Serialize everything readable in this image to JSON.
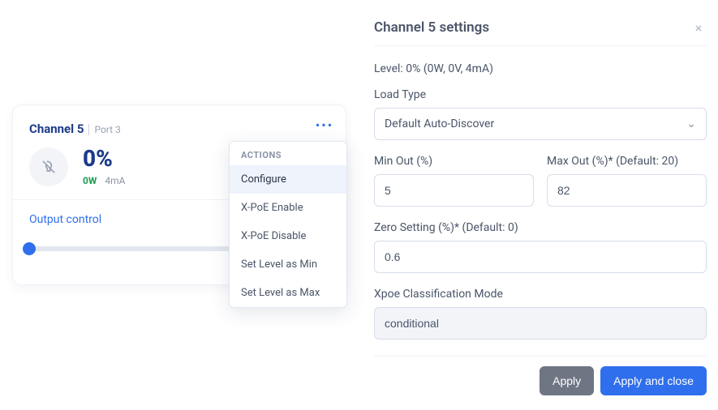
{
  "card": {
    "title": "Channel 5",
    "port_label": "Port 3",
    "percent": "0%",
    "power": "0W",
    "current": "4mA",
    "output_label": "Output control",
    "output_value": "0"
  },
  "actions": {
    "heading": "ACTIONS",
    "items": [
      {
        "label": "Configure",
        "active": true
      },
      {
        "label": "X-PoE Enable",
        "active": false
      },
      {
        "label": "X-PoE Disable",
        "active": false
      },
      {
        "label": "Set Level as Min",
        "active": false
      },
      {
        "label": "Set Level as Max",
        "active": false
      }
    ]
  },
  "panel": {
    "title": "Channel 5 settings",
    "level_text": "Level: 0% (0W, 0V, 4mA)",
    "load_type_label": "Load Type",
    "load_type_value": "Default Auto-Discover",
    "min_out_label": "Min Out (%)",
    "min_out_value": "5",
    "max_out_label": "Max Out (%)* (Default: 20)",
    "max_out_value": "82",
    "zero_label": "Zero Setting (%)* (Default: 0)",
    "zero_value": "0.6",
    "xpoe_label": "Xpoe Classification Mode",
    "xpoe_value": "conditional",
    "apply_label": "Apply",
    "apply_close_label": "Apply and close"
  }
}
